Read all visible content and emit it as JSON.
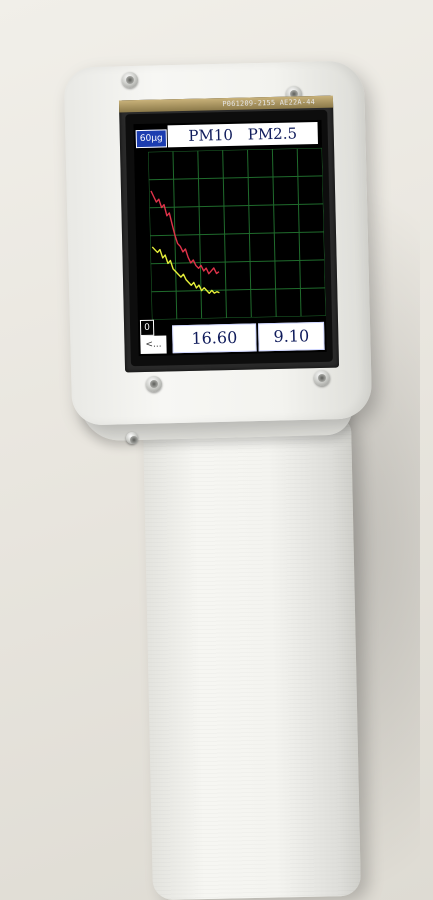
{
  "pcb": {
    "label": "P061209-2155  AE22A-44"
  },
  "screen": {
    "max_label": "60µg",
    "min_label": "0",
    "series_labels": [
      "PM10",
      "PM2.5"
    ],
    "back_label": "<...",
    "values": {
      "pm10": "16.60",
      "pm25": "9.10"
    }
  },
  "chart_data": {
    "type": "line",
    "ylim": [
      0,
      60
    ],
    "grid": true,
    "series": [
      {
        "name": "PM10",
        "color": "#e0334a",
        "values": [
          46,
          44,
          42,
          43,
          40,
          41,
          37,
          38,
          34,
          30,
          27,
          26,
          24,
          25,
          22,
          20,
          21,
          19,
          18,
          19,
          17,
          18,
          16,
          17,
          18,
          16,
          16.6
        ]
      },
      {
        "name": "PM2.5",
        "color": "#e6ef3a",
        "values": [
          26,
          25,
          24,
          25,
          22,
          23,
          20,
          21,
          18,
          17,
          16,
          15,
          16,
          14,
          13,
          12,
          13,
          11,
          12,
          10,
          11,
          10,
          9,
          10,
          9,
          9.5,
          9.1
        ]
      }
    ]
  }
}
